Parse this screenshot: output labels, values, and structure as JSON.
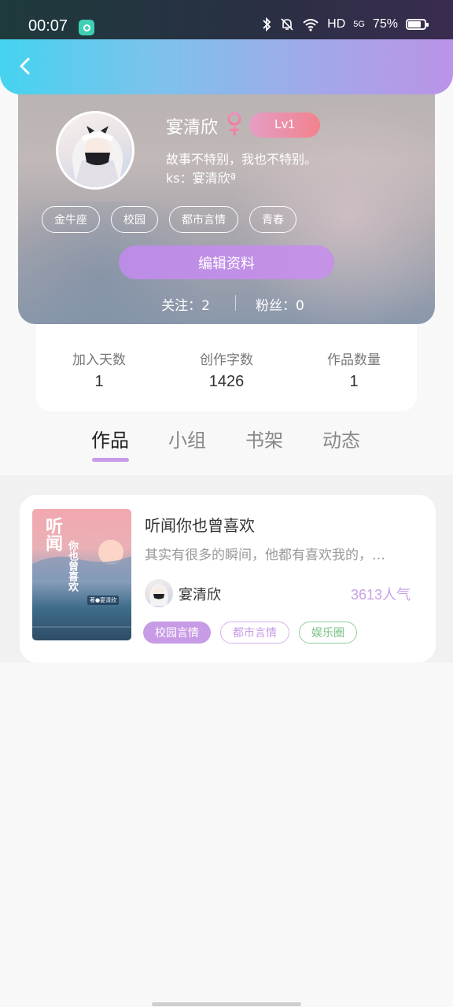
{
  "status_bar": {
    "time": "00:07",
    "network": "HD",
    "signal": "5G",
    "battery": "75%",
    "icons": [
      "bluetooth-icon",
      "mute-icon",
      "wifi-icon",
      "battery-icon"
    ]
  },
  "profile": {
    "nickname": "宴清欣",
    "gender": "female",
    "level": "Lv1",
    "bio": "故事不特别，我也不特别。",
    "ks": "ks：宴清欣ª",
    "tags": [
      "金牛座",
      "校园",
      "都市言情",
      "青春"
    ],
    "edit_button": "编辑资料",
    "following": "关注：2",
    "followers": "粉丝：0"
  },
  "stats": [
    {
      "label": "加入天数",
      "value": "1"
    },
    {
      "label": "创作字数",
      "value": "1426"
    },
    {
      "label": "作品数量",
      "value": "1"
    }
  ],
  "tabs": [
    "作品",
    "小组",
    "书架",
    "动态"
  ],
  "active_tab": "作品",
  "works": [
    {
      "title": "听闻你也曾喜欢",
      "description": "其实有很多的瞬间，他都有喜欢我的，…",
      "author": "宴清欣",
      "popularity": "3613",
      "popularity_unit": "人气",
      "tags": [
        "校园言情",
        "都市言情",
        "娱乐圈"
      ],
      "cover": {
        "title_large": "听闻",
        "title_small": "你也曾喜欢",
        "author_tag": "著●宴清欣"
      }
    }
  ],
  "colors": {
    "accent_purple": "#c79be6",
    "header_gradient_start": "#45d3f0",
    "header_gradient_end": "#bb93e8",
    "level_badge": "#f3828e",
    "tag_green": "#79c086"
  }
}
